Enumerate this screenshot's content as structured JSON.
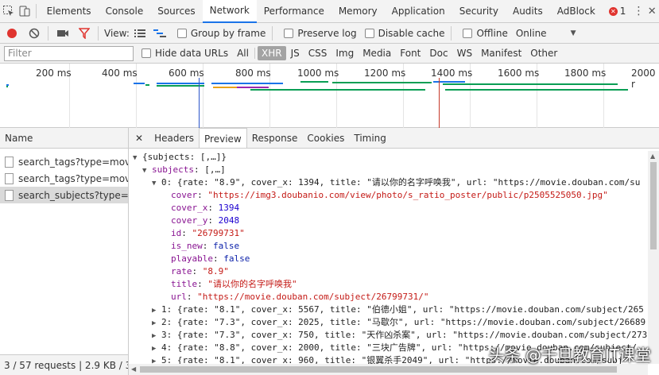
{
  "topbar": {
    "tabs": [
      "Elements",
      "Console",
      "Sources",
      "Network",
      "Performance",
      "Memory",
      "Application",
      "Security",
      "Audits",
      "AdBlock"
    ],
    "active_tab": "Network",
    "error_count": "1"
  },
  "toolbar": {
    "view_label": "View:",
    "group_by_frame": "Group by frame",
    "preserve_log": "Preserve log",
    "disable_cache": "Disable cache",
    "offline": "Offline",
    "throttle": "Online"
  },
  "filterbar": {
    "placeholder": "Filter",
    "hide_data_urls": "Hide data URLs",
    "types": [
      "All",
      "XHR",
      "JS",
      "CSS",
      "Img",
      "Media",
      "Font",
      "Doc",
      "WS",
      "Manifest",
      "Other"
    ],
    "selected_type": "XHR"
  },
  "timeline": {
    "ticks": [
      "200 ms",
      "400 ms",
      "600 ms",
      "800 ms",
      "1000 ms",
      "1200 ms",
      "1400 ms",
      "1600 ms",
      "1800 ms",
      "2000 r"
    ]
  },
  "requests": {
    "header": "Name",
    "items": [
      "search_tags?type=movi...",
      "search_tags?type=movi...",
      "search_subjects?type=..."
    ],
    "selected_index": 2,
    "status": "3 / 57 requests  |  2.9 KB / 3..."
  },
  "detail": {
    "tabs": [
      "Headers",
      "Preview",
      "Response",
      "Cookies",
      "Timing"
    ],
    "active_tab": "Preview",
    "lines": {
      "l0": "{subjects: [,…]}",
      "l1_key": "subjects",
      "l1_val": "[,…]",
      "l2": "0: {rate: \"8.9\", cover_x: 1394, title: \"请以你的名字呼唤我\", url: \"https://movie.douban.com/su",
      "cover_key": "cover",
      "cover_val": "\"https://img3.doubanio.com/view/photo/s_ratio_poster/public/p2505525050.jpg\"",
      "cover_x_key": "cover_x",
      "cover_x_val": "1394",
      "cover_y_key": "cover_y",
      "cover_y_val": "2048",
      "id_key": "id",
      "id_val": "\"26799731\"",
      "is_new_key": "is_new",
      "is_new_val": "false",
      "playable_key": "playable",
      "playable_val": "false",
      "rate_key": "rate",
      "rate_val": "\"8.9\"",
      "title_key": "title",
      "title_val": "\"请以你的名字呼唤我\"",
      "url_key": "url",
      "url_val": "\"https://movie.douban.com/subject/26799731/\"",
      "r1": "1: {rate: \"8.1\", cover_x: 5567, title: \"伯德小姐\", url: \"https://movie.douban.com/subject/265",
      "r2": "2: {rate: \"7.3\", cover_x: 2025, title: \"马歇尔\", url: \"https://movie.douban.com/subject/26689",
      "r3": "3: {rate: \"7.3\", cover_x: 750, title: \"天作凶杀案\", url: \"https://movie.douban.com/subject/273",
      "r4": "4: {rate: \"8.8\", cover_x: 2000, title: \"三块广告牌\", url: \"https://movie.douban.com/subject/",
      "r5": "5: {rate: \"8.1\", cover_x: 960, title: \"银翼杀手2049\", url: \"https://movie.douban.com/subj"
    }
  },
  "watermark": "头条 @千旦教育IT课堂",
  "colors": {
    "accent": "#1a73e8",
    "record": "#e0342f",
    "filter": "#e0342f"
  }
}
